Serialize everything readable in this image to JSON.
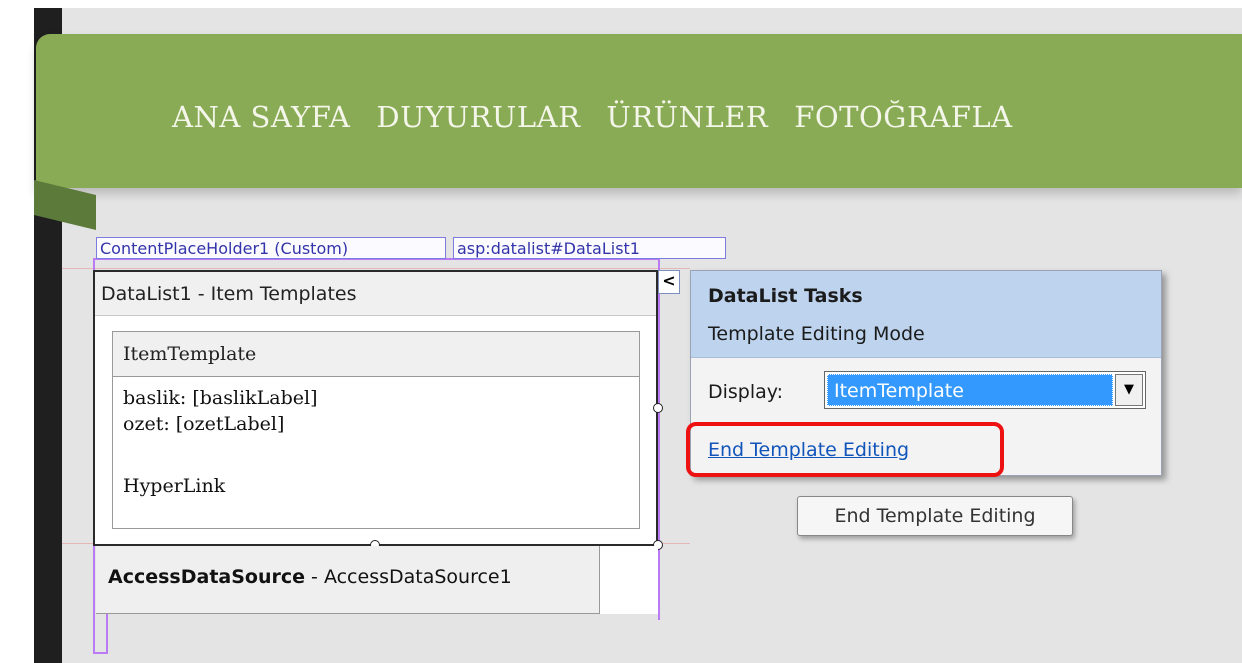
{
  "nav": {
    "items": [
      "ANA SAYFA",
      "DUYURULAR",
      "ÜRÜNLER",
      "FOTOĞRAFLA"
    ]
  },
  "tags": {
    "placeholder": "ContentPlaceHolder1 (Custom)",
    "datalist": "asp:datalist#DataList1"
  },
  "datalist": {
    "header": "DataList1 - Item Templates",
    "template_header": "ItemTemplate",
    "lines": [
      "baslik: [baslikLabel]",
      "ozet: [ozetLabel]",
      "HyperLink"
    ]
  },
  "datasource": {
    "bold": "AccessDataSource",
    "rest": " - AccessDataSource1"
  },
  "tasks": {
    "chevron": "<",
    "title": "DataList Tasks",
    "subtitle": "Template Editing Mode",
    "display_label": "Display:",
    "display_value": "ItemTemplate",
    "dropdown_arrow": "▼",
    "end_link": "End Template Editing"
  },
  "tooltip": "End Template Editing",
  "colors": {
    "banner": "#8aab55",
    "highlight": "#ee1111",
    "tasks_header": "#bdd3ee",
    "selection": "#3399ff"
  }
}
